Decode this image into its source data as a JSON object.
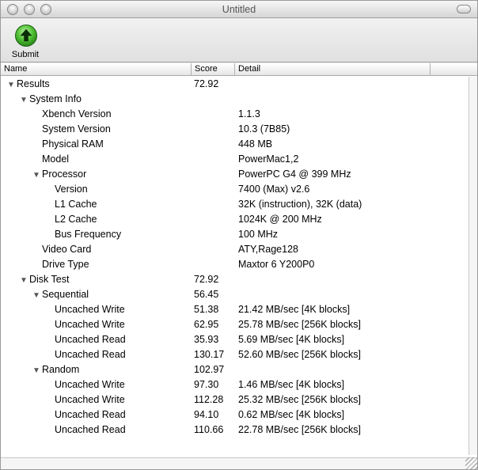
{
  "window": {
    "title": "Untitled"
  },
  "toolbar": {
    "submit_label": "Submit"
  },
  "table": {
    "columns": {
      "name": "Name",
      "score": "Score",
      "detail": "Detail"
    },
    "rows": [
      {
        "name": "Results",
        "score": "72.92",
        "detail": "",
        "level": 0,
        "expanded": true
      },
      {
        "name": "System Info",
        "score": "",
        "detail": "",
        "level": 1,
        "expanded": true
      },
      {
        "name": "Xbench Version",
        "score": "",
        "detail": "1.1.3",
        "level": 2
      },
      {
        "name": "System Version",
        "score": "",
        "detail": "10.3 (7B85)",
        "level": 2
      },
      {
        "name": "Physical RAM",
        "score": "",
        "detail": "448 MB",
        "level": 2
      },
      {
        "name": "Model",
        "score": "",
        "detail": "PowerMac1,2",
        "level": 2
      },
      {
        "name": "Processor",
        "score": "",
        "detail": "PowerPC G4 @ 399 MHz",
        "level": 2,
        "expanded": true
      },
      {
        "name": "Version",
        "score": "",
        "detail": "7400 (Max) v2.6",
        "level": 3
      },
      {
        "name": "L1 Cache",
        "score": "",
        "detail": "32K (instruction), 32K (data)",
        "level": 3
      },
      {
        "name": "L2 Cache",
        "score": "",
        "detail": "1024K @ 200 MHz",
        "level": 3
      },
      {
        "name": "Bus Frequency",
        "score": "",
        "detail": "100 MHz",
        "level": 3
      },
      {
        "name": "Video Card",
        "score": "",
        "detail": "ATY,Rage128",
        "level": 2
      },
      {
        "name": "Drive Type",
        "score": "",
        "detail": "Maxtor 6 Y200P0",
        "level": 2
      },
      {
        "name": "Disk Test",
        "score": "72.92",
        "detail": "",
        "level": 1,
        "expanded": true
      },
      {
        "name": "Sequential",
        "score": "56.45",
        "detail": "",
        "level": 2,
        "expanded": true
      },
      {
        "name": "Uncached Write",
        "score": "51.38",
        "detail": "21.42 MB/sec [4K blocks]",
        "level": 3
      },
      {
        "name": "Uncached Write",
        "score": "62.95",
        "detail": "25.78 MB/sec [256K blocks]",
        "level": 3
      },
      {
        "name": "Uncached Read",
        "score": "35.93",
        "detail": "5.69 MB/sec [4K blocks]",
        "level": 3
      },
      {
        "name": "Uncached Read",
        "score": "130.17",
        "detail": "52.60 MB/sec [256K blocks]",
        "level": 3
      },
      {
        "name": "Random",
        "score": "102.97",
        "detail": "",
        "level": 2,
        "expanded": true
      },
      {
        "name": "Uncached Write",
        "score": "97.30",
        "detail": "1.46 MB/sec [4K blocks]",
        "level": 3
      },
      {
        "name": "Uncached Write",
        "score": "112.28",
        "detail": "25.32 MB/sec [256K blocks]",
        "level": 3
      },
      {
        "name": "Uncached Read",
        "score": "94.10",
        "detail": "0.62 MB/sec [4K blocks]",
        "level": 3
      },
      {
        "name": "Uncached Read",
        "score": "110.66",
        "detail": "22.78 MB/sec [256K blocks]",
        "level": 3
      }
    ]
  }
}
